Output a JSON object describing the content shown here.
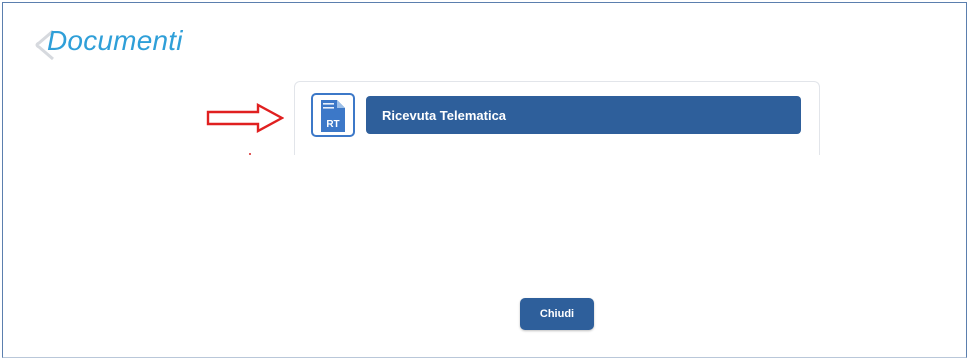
{
  "header": {
    "title": "Documenti"
  },
  "documents": {
    "items": [
      {
        "icon": "rt-document-icon",
        "icon_text": "RT",
        "label": "Ricevuta Telematica"
      }
    ]
  },
  "annotation": {
    "icon": "red-outline-arrow-icon",
    "color": "#e02020"
  },
  "footer": {
    "close_label": "Chiudi"
  },
  "colors": {
    "title": "#2f9fd8",
    "button_bg": "#2e5f9b",
    "icon_border": "#3c78c8",
    "icon_fill": "#3c78c8"
  }
}
